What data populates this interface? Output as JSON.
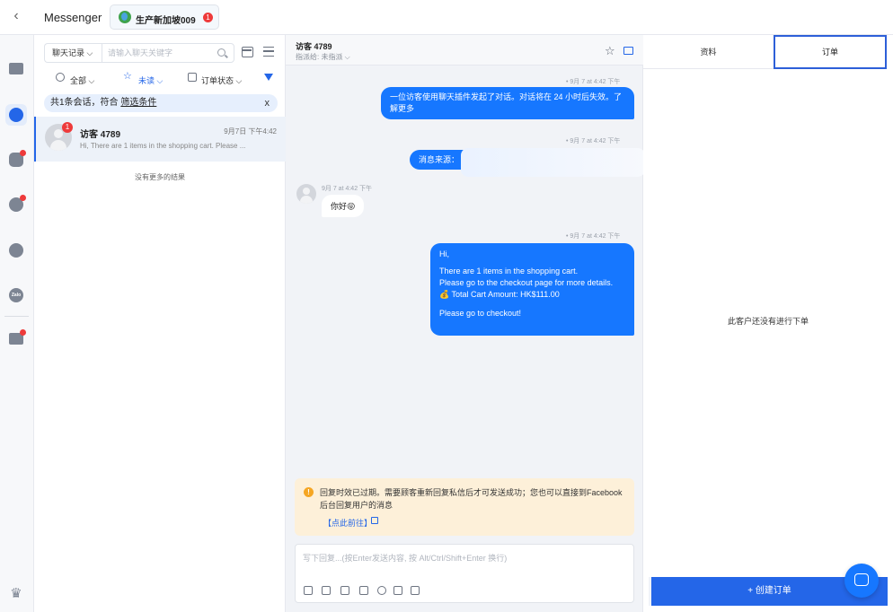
{
  "topbar": {
    "back_icon": "chevron-left-icon",
    "app_title": "Messenger",
    "page_tab": {
      "label": "生产新加坡009",
      "badge": "1",
      "icon": "globe-icon"
    }
  },
  "rail": {
    "items": [
      {
        "name": "shop",
        "icon": "store-icon",
        "active": false,
        "dot": false
      },
      {
        "name": "messenger",
        "icon": "messenger-icon",
        "active": true,
        "dot": false
      },
      {
        "name": "instagram",
        "icon": "instagram-icon",
        "active": false,
        "dot": true
      },
      {
        "name": "whatsapp",
        "icon": "whatsapp-icon",
        "active": false,
        "dot": true
      },
      {
        "name": "telegram",
        "icon": "telegram-icon",
        "active": false,
        "dot": false
      },
      {
        "name": "zalo",
        "icon": "zalo-icon",
        "label": "Zalo",
        "active": false,
        "dot": false
      },
      {
        "name": "gallery",
        "icon": "image-icon",
        "active": false,
        "dot": true
      }
    ],
    "bottom_icon": "crown-icon"
  },
  "list": {
    "search_type": "聊天记录 ⌵",
    "search_placeholder": "请输入聊天关键字",
    "filters": {
      "all": "全部 ⌵",
      "unread": "未读 ⌵",
      "order_status": "订单状态 ⌵"
    },
    "result_text": "共1条会话，符合 ",
    "result_link": "筛选条件",
    "result_close": "x",
    "conversation": {
      "name": "访客 4789",
      "time": "9月7日 下午4:42",
      "preview": "Hi, There are 1 items in the shopping cart. Please ...",
      "badge": "1"
    },
    "no_more": "没有更多的结果"
  },
  "chat": {
    "header": {
      "name": "访客 4789",
      "assignee": "指派给:  未指派 ⌵"
    },
    "messages": [
      {
        "meta": "• 9月 7 at 4:42 下午",
        "text": "一位访客使用聊天插件发起了对话。对话将在 24 小时后失效。了解更多"
      },
      {
        "meta": "• 9月 7 at 4:42 下午",
        "text": "消息来源："
      },
      {
        "meta": "9月 7 at 4:42 下午",
        "text": "你好😝"
      },
      {
        "meta": "• 9月 7 at 4:42 下午",
        "lines": [
          "Hi,",
          "There are 1 items in the shopping cart.",
          "Please go to the checkout page for more details.",
          "💰 Total Cart Amount: HK$111.00",
          "Please go to checkout!"
        ]
      }
    ],
    "warning": {
      "text": "回复时效已过期。需要顾客重新回复私信后才可发送成功；您也可以直接到Facebook后台回复用户的消息",
      "link": "【点此前往】"
    },
    "reply_placeholder": "写下回复...(按Enter发送内容, 按 Alt/Ctrl/Shift+Enter 换行)"
  },
  "right": {
    "tab_info": "资料",
    "tab_order": "订单",
    "empty_text": "此客户还没有进行下单",
    "create_order": "+ 创建订单"
  },
  "colors": {
    "accent": "#2466e8",
    "bubble": "#1677ff",
    "badge": "#ee3a3a",
    "warning_bg": "#fdf0d9"
  }
}
